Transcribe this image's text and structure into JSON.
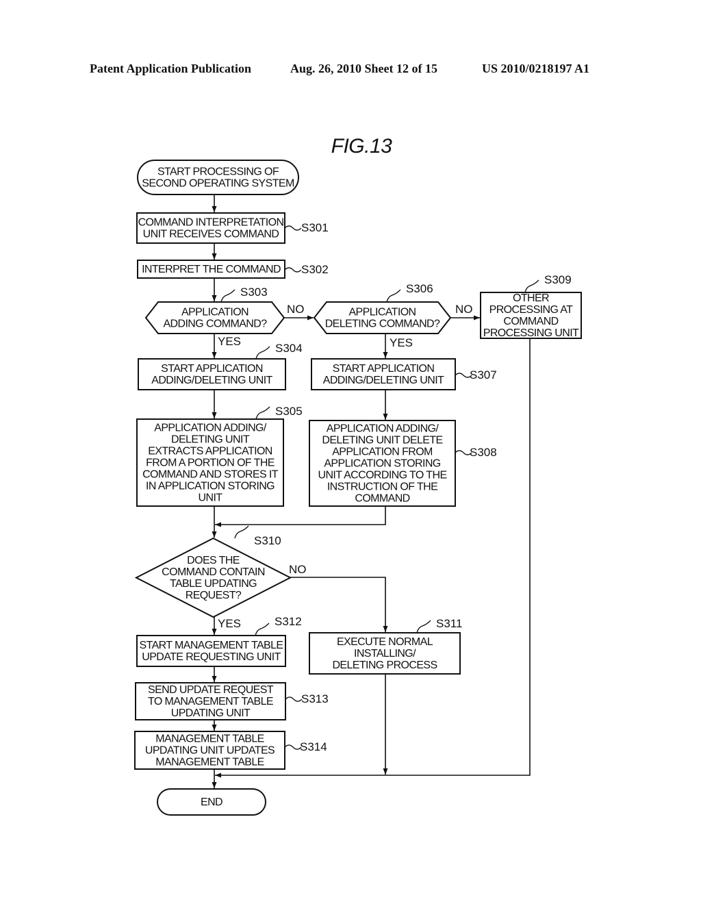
{
  "header": {
    "publication": "Patent Application Publication",
    "date_sheet": "Aug. 26, 2010  Sheet 12 of 15",
    "number": "US 2010/0218197 A1"
  },
  "figure": {
    "title": "FIG.13",
    "nodes": {
      "start": {
        "type": "terminal",
        "lines": [
          "START PROCESSING OF",
          "SECOND OPERATING SYSTEM"
        ]
      },
      "s301": {
        "type": "process",
        "step": "S301",
        "lines": [
          "COMMAND INTERPRETATION",
          "UNIT RECEIVES COMMAND"
        ]
      },
      "s302": {
        "type": "process",
        "step": "S302",
        "lines": [
          "INTERPRET THE COMMAND"
        ]
      },
      "s303": {
        "type": "decision",
        "step": "S303",
        "lines": [
          "APPLICATION",
          "ADDING COMMAND?"
        ]
      },
      "s306": {
        "type": "decision",
        "step": "S306",
        "lines": [
          "APPLICATION",
          "DELETING COMMAND?"
        ]
      },
      "s309": {
        "type": "process",
        "step": "S309",
        "lines": [
          "OTHER",
          "PROCESSING AT",
          "COMMAND",
          "PROCESSING UNIT"
        ]
      },
      "s304": {
        "type": "process",
        "step": "S304",
        "lines": [
          "START APPLICATION",
          "ADDING/DELETING UNIT"
        ]
      },
      "s307": {
        "type": "process",
        "step": "S307",
        "lines": [
          "START APPLICATION",
          "ADDING/DELETING UNIT"
        ]
      },
      "s305": {
        "type": "process",
        "step": "S305",
        "lines": [
          "APPLICATION ADDING/",
          "DELETING UNIT",
          "EXTRACTS APPLICATION",
          "FROM A PORTION OF THE",
          "COMMAND AND STORES IT",
          "IN APPLICATION STORING",
          "UNIT"
        ]
      },
      "s308": {
        "type": "process",
        "step": "S308",
        "lines": [
          "APPLICATION ADDING/",
          "DELETING UNIT DELETE",
          "APPLICATION FROM",
          "APPLICATION STORING",
          "UNIT ACCORDING TO THE",
          "INSTRUCTION OF THE",
          "COMMAND"
        ]
      },
      "s310": {
        "type": "decision",
        "step": "S310",
        "lines": [
          "DOES THE",
          "COMMAND CONTAIN",
          "TABLE UPDATING",
          "REQUEST?"
        ]
      },
      "s311": {
        "type": "process",
        "step": "S311",
        "lines": [
          "EXECUTE NORMAL",
          "INSTALLING/",
          "DELETING PROCESS"
        ]
      },
      "s312": {
        "type": "process",
        "step": "S312",
        "lines": [
          "START MANAGEMENT TABLE",
          "UPDATE REQUESTING UNIT"
        ]
      },
      "s313": {
        "type": "process",
        "step": "S313",
        "lines": [
          "SEND UPDATE REQUEST",
          "TO MANAGEMENT TABLE",
          "UPDATING UNIT"
        ]
      },
      "s314": {
        "type": "process",
        "step": "S314",
        "lines": [
          "MANAGEMENT TABLE",
          "UPDATING UNIT UPDATES",
          "MANAGEMENT TABLE"
        ]
      },
      "end": {
        "type": "terminal",
        "lines": [
          "END"
        ]
      }
    },
    "edges": [
      {
        "from": "start",
        "to": "s301",
        "label": ""
      },
      {
        "from": "s301",
        "to": "s302",
        "label": ""
      },
      {
        "from": "s302",
        "to": "s303",
        "label": ""
      },
      {
        "from": "s303",
        "to": "s306",
        "label": "NO"
      },
      {
        "from": "s306",
        "to": "s309",
        "label": "NO"
      },
      {
        "from": "s303",
        "to": "s304",
        "label": "YES"
      },
      {
        "from": "s306",
        "to": "s307",
        "label": "YES"
      },
      {
        "from": "s304",
        "to": "s305",
        "label": ""
      },
      {
        "from": "s307",
        "to": "s308",
        "label": ""
      },
      {
        "from": "s305",
        "to": "s310",
        "label": ""
      },
      {
        "from": "s308",
        "to": "s310",
        "label": ""
      },
      {
        "from": "s310",
        "to": "s312",
        "label": "YES"
      },
      {
        "from": "s310",
        "to": "s311",
        "label": "NO"
      },
      {
        "from": "s312",
        "to": "s313",
        "label": ""
      },
      {
        "from": "s313",
        "to": "s314",
        "label": ""
      },
      {
        "from": "s314",
        "to": "end",
        "label": ""
      },
      {
        "from": "s311",
        "to": "end",
        "label": ""
      },
      {
        "from": "s309",
        "to": "end",
        "label": ""
      }
    ]
  }
}
